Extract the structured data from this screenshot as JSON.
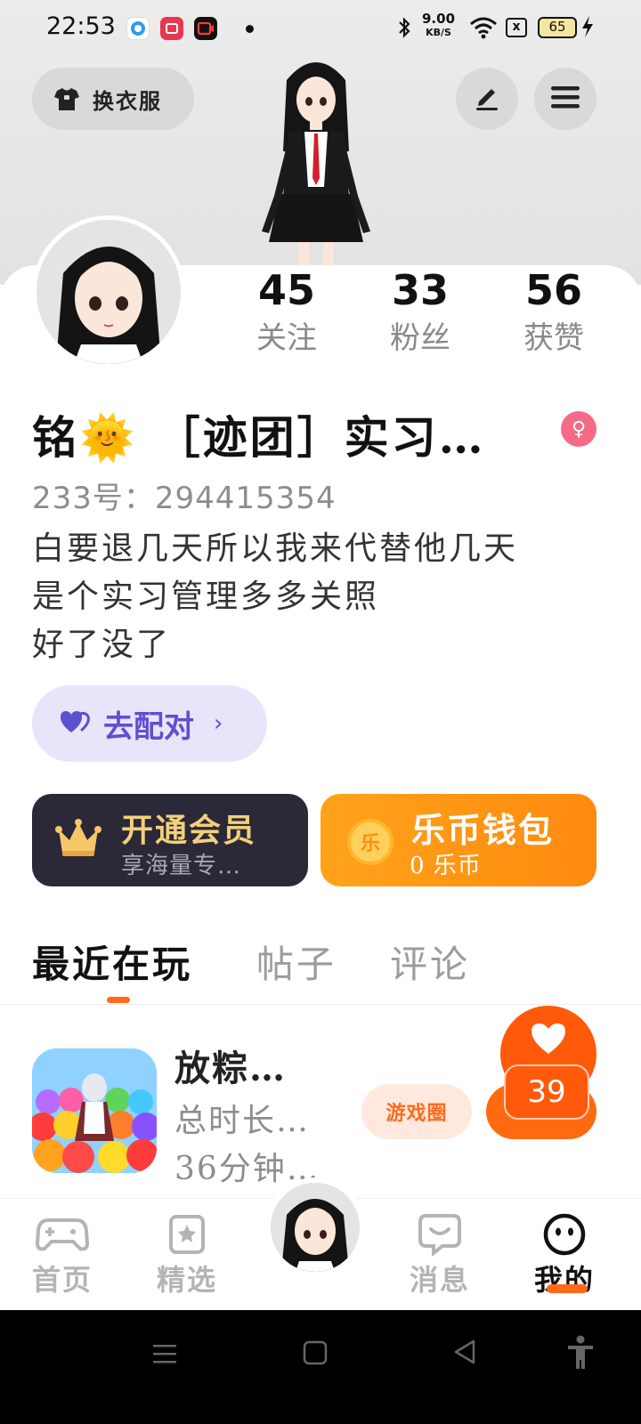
{
  "status_bar": {
    "time": "22:53",
    "net_speed_value": "9.00",
    "net_speed_unit": "KB/S",
    "sim_icon": "x",
    "battery": "65",
    "icons": [
      "bluetooth-icon",
      "wifi-icon",
      "sim-icon",
      "battery-icon",
      "charging-icon"
    ]
  },
  "header": {
    "outfit_label": "换衣服",
    "edit_icon": "pencil-icon",
    "menu_icon": "hamburger-menu-icon"
  },
  "profile": {
    "stats": [
      {
        "value": "45",
        "label": "关注"
      },
      {
        "value": "33",
        "label": "粉丝"
      },
      {
        "value": "56",
        "label": "获赞"
      }
    ],
    "name": "铭🌞 ［迹团］实习…",
    "gender_icon": "♀",
    "uid": "233号：294415354",
    "bio_lines": [
      "白要退几天所以我来代替他几天",
      "是个实习管理多多关照",
      "好了没了"
    ],
    "match_label": "去配对"
  },
  "cards": {
    "vip": {
      "title": "开通会员",
      "subtitle": "享海量专…"
    },
    "wallet": {
      "title": "乐币钱包",
      "subtitle": "0 乐币",
      "coin_text": "乐"
    }
  },
  "tabs": [
    {
      "label": "最近在玩",
      "active": true
    },
    {
      "label": "帖子",
      "active": false
    },
    {
      "label": "评论",
      "active": false
    }
  ],
  "recent_game": {
    "name": "放粽…",
    "line1": "总时长…",
    "line2": "36分钟…",
    "circle_label": "游戏圈",
    "like_count": "39"
  },
  "bottom_nav": [
    {
      "label": "首页",
      "icon": "gamepad-icon",
      "active": false
    },
    {
      "label": "精选",
      "icon": "star-card-icon",
      "active": false
    },
    {
      "label": "消息",
      "icon": "chat-bubble-icon",
      "active": false
    },
    {
      "label": "我的",
      "icon": "smiley-face-icon",
      "active": true
    }
  ],
  "colors": {
    "accent": "#ff6a1a",
    "vip_bg": "#2b2838",
    "vip_text": "#f3d07b",
    "wallet_bg": "#ff9a16",
    "match_bg": "#e8e5fb",
    "match_text": "#5f4fd1"
  }
}
